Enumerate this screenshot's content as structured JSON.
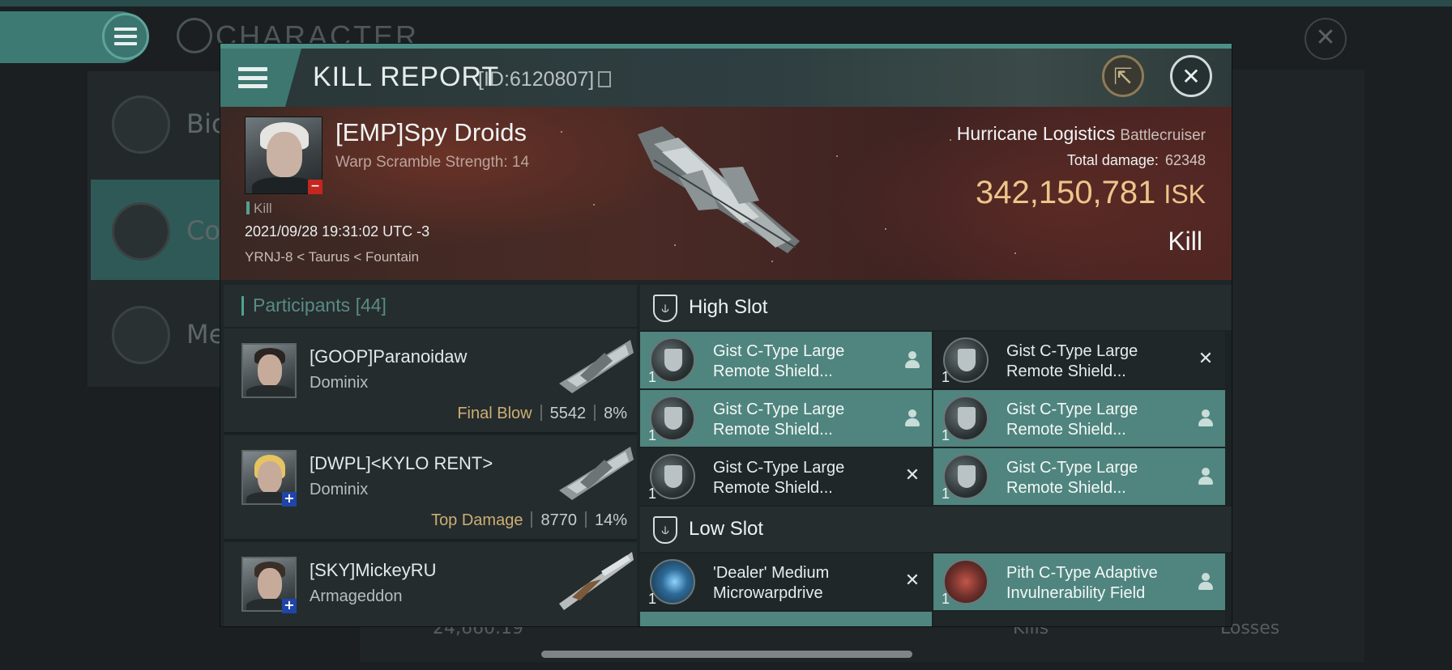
{
  "background": {
    "screen_title": "CHARACTER",
    "nav_items": [
      {
        "label": "Bio",
        "icon": "list-icon",
        "active": false
      },
      {
        "label": "Co",
        "icon": "crossed-swords-icon",
        "active": true
      },
      {
        "label": "Me",
        "icon": "star-icon",
        "active": false
      }
    ],
    "bottom_value": "24,660.19",
    "bottom_tabs": [
      "Kills",
      "Losses"
    ]
  },
  "dialog": {
    "title": "KILL REPORT",
    "id_label": "[ID:6120807]",
    "share_icon": "external-link-icon",
    "close_icon": "close-icon"
  },
  "victim": {
    "name": "[EMP]Spy Droids",
    "subtitle": "Warp Scramble Strength: 14",
    "kill_label": "Kill",
    "datetime": "2021/09/28 19:31:02 UTC -3",
    "location": "YRNJ-8 < Taurus < Fountain",
    "standing_badge": "−"
  },
  "ship": {
    "name": "Hurricane Logistics",
    "class": "Battlecruiser",
    "total_damage_label": "Total damage:",
    "total_damage": "62348",
    "isk_value": "342,150,781",
    "isk_unit": "ISK",
    "result": "Kill"
  },
  "participants": {
    "header_label": "Participants",
    "count": "[44]",
    "rows": [
      {
        "name": "[GOOP]Paranoidaw",
        "ship": "Dominix",
        "tag": "Final Blow",
        "damage": "5542",
        "percent": "8%",
        "badge": "",
        "hair": "#2a2523"
      },
      {
        "name": "[DWPL]<KYLO RENT>",
        "ship": "Dominix",
        "tag": "Top Damage",
        "damage": "8770",
        "percent": "14%",
        "badge": "+",
        "hair": "#e6c460"
      },
      {
        "name": "[SKY]MickeyRU",
        "ship": "Armageddon",
        "tag": "",
        "damage": "",
        "percent": "",
        "badge": "+",
        "hair": "#3a2f28"
      }
    ]
  },
  "slots": {
    "high": {
      "title": "High Slot",
      "modules": [
        {
          "qty": "1",
          "line1": "Gist C-Type Large",
          "line2": "Remote Shield...",
          "state": "dropped"
        },
        {
          "qty": "1",
          "line1": "Gist C-Type Large",
          "line2": "Remote Shield...",
          "state": "destroyed"
        },
        {
          "qty": "1",
          "line1": "Gist C-Type Large",
          "line2": "Remote Shield...",
          "state": "dropped"
        },
        {
          "qty": "1",
          "line1": "Gist C-Type Large",
          "line2": "Remote Shield...",
          "state": "dropped"
        },
        {
          "qty": "1",
          "line1": "Gist C-Type Large",
          "line2": "Remote Shield...",
          "state": "destroyed"
        },
        {
          "qty": "1",
          "line1": "Gist C-Type Large",
          "line2": "Remote Shield...",
          "state": "dropped"
        }
      ]
    },
    "low": {
      "title": "Low Slot",
      "modules": [
        {
          "qty": "1",
          "line1": "'Dealer' Medium",
          "line2": "Microwarpdrive",
          "state": "destroyed"
        },
        {
          "qty": "1",
          "line1": "Pith C-Type Adaptive",
          "line2": "Invulnerability Field",
          "state": "dropped"
        }
      ]
    }
  },
  "colors": {
    "accent_teal": "#4f857e",
    "isk_gold": "#eec58a",
    "tag_gold": "#cdae73"
  }
}
